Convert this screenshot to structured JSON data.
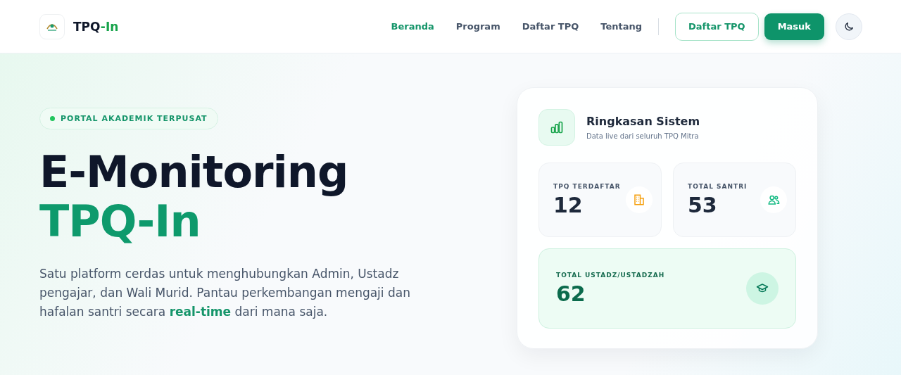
{
  "header": {
    "brand_main": "TPQ",
    "brand_accent": "-In",
    "nav": [
      {
        "label": "Beranda",
        "selected": true
      },
      {
        "label": "Program",
        "selected": false
      },
      {
        "label": "Daftar TPQ",
        "selected": false
      },
      {
        "label": "Tentang",
        "selected": false
      }
    ],
    "register_button": "Daftar TPQ",
    "login_button": "Masuk"
  },
  "hero": {
    "badge": "PORTAL AKADEMIK TERPUSAT",
    "title_line_1": "E-Monitoring",
    "title_line_2": "TPQ-In",
    "description": "Satu platform cerdas untuk menghubungkan Admin, Ustadz pengajar, dan Wali Murid. Pantau perkembangan mengaji dan hafalan santri secara **real-time** dari mana saja."
  },
  "summary": {
    "title": "Ringkasan Sistem",
    "subtitle": "Data live dari seluruh TPQ Mitra",
    "stats": [
      {
        "kind": "small",
        "label": "TPQ TERDAFTAR",
        "value": "12"
      },
      {
        "kind": "small",
        "label": "TOTAL SANTRI",
        "value": "53"
      },
      {
        "kind": "wide",
        "label": "TOTAL USTADZ/USTADZAH",
        "value": "62"
      }
    ]
  }
}
